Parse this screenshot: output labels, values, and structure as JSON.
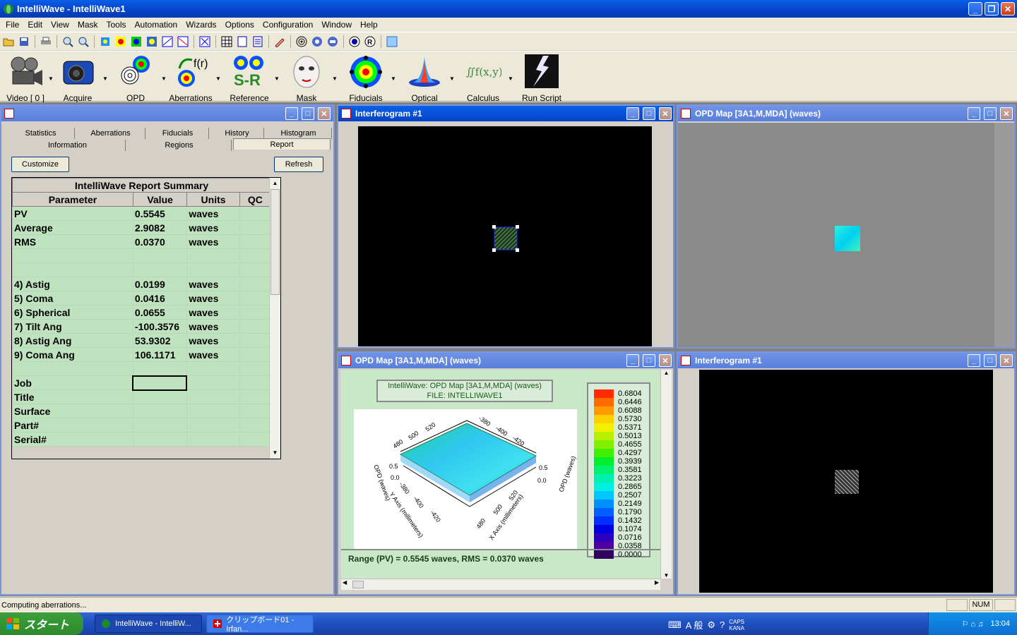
{
  "app": {
    "title": "IntelliWave - IntelliWave1",
    "menu": [
      "File",
      "Edit",
      "View",
      "Mask",
      "Tools",
      "Automation",
      "Wizards",
      "Options",
      "Configuration",
      "Window",
      "Help"
    ],
    "big_toolbar": [
      "Video [ 0 ]",
      "Acquire",
      "OPD",
      "Aberrations",
      "Reference",
      "Mask",
      "Fiducials",
      "Optical",
      "Calculus",
      "Run Script"
    ],
    "sr_text": "S-R",
    "fr_text": "f(r)",
    "calc_text": "∬f(x,y) dx dy",
    "status_text": "Computing aberrations...",
    "num_indicator": "NUM"
  },
  "panel": {
    "tabs_row1": [
      "Statistics",
      "Aberrations",
      "Fiducials",
      "History",
      "Histogram"
    ],
    "tabs_row2": [
      "Information",
      "Regions",
      "Report"
    ],
    "customize_label": "Customize",
    "refresh_label": "Refresh",
    "report_title": "IntelliWave Report Summary",
    "headers": [
      "Parameter",
      "Value",
      "Units",
      "QC"
    ],
    "rows": [
      {
        "p": "PV",
        "v": "0.5545",
        "u": "waves"
      },
      {
        "p": "Average",
        "v": "2.9082",
        "u": "waves"
      },
      {
        "p": "RMS",
        "v": "0.0370",
        "u": "waves"
      },
      {
        "p": "",
        "v": "",
        "u": ""
      },
      {
        "p": "",
        "v": "",
        "u": ""
      },
      {
        "p": " 4) Astig",
        "v": "0.0199",
        "u": "waves"
      },
      {
        "p": " 5) Coma",
        "v": "0.0416",
        "u": "waves"
      },
      {
        "p": " 6) Spherical",
        "v": "0.0655",
        "u": "waves"
      },
      {
        "p": " 7) Tilt Ang",
        "v": "-100.3576",
        "u": "waves"
      },
      {
        "p": " 8) Astig Ang",
        "v": "53.9302",
        "u": "waves"
      },
      {
        "p": " 9) Coma Ang",
        "v": "106.1171",
        "u": "waves"
      },
      {
        "p": "",
        "v": "",
        "u": ""
      },
      {
        "p": "Job",
        "v": "",
        "u": ""
      },
      {
        "p": "Title",
        "v": "",
        "u": ""
      },
      {
        "p": "Surface",
        "v": "",
        "u": ""
      },
      {
        "p": "Part#",
        "v": "",
        "u": ""
      },
      {
        "p": "Serial#",
        "v": "",
        "u": ""
      }
    ]
  },
  "windows": {
    "interferogram_top": "Interferogram #1",
    "opd_top": "OPD Map [3A1,M,MDA]  (waves)",
    "opd_bottom": "OPD Map [3A1,M,MDA]  (waves)",
    "interferogram_bottom": "Interferogram #1"
  },
  "plot": {
    "caption_line1": "IntelliWave: OPD Map [3A1,M,MDA]  (waves)",
    "caption_line2": "FILE: INTELLIWAVE1",
    "range_text": "Range (PV) =   0.5545 waves, RMS =   0.0370 waves",
    "legend_values": [
      "0.6804",
      "0.6446",
      "0.6088",
      "0.5730",
      "0.5371",
      "0.5013",
      "0.4655",
      "0.4297",
      "0.3939",
      "0.3581",
      "0.3223",
      "0.2865",
      "0.2507",
      "0.2149",
      "0.1790",
      "0.1432",
      "0.1074",
      "0.0716",
      "0.0358",
      "0.0000"
    ],
    "legend_colors": [
      "#ff2a00",
      "#ff6a00",
      "#ff9a00",
      "#ffd000",
      "#f0f000",
      "#b8f000",
      "#80f000",
      "#40f000",
      "#00f030",
      "#00f070",
      "#00f0b0",
      "#00f0e0",
      "#00c8ff",
      "#0090ff",
      "#0060ff",
      "#0030ff",
      "#0000e0",
      "#3000c0",
      "#5000a0",
      "#300060"
    ],
    "axis_left_opd": "OPD (waves)",
    "axis_right_opd": "OPD (waves)",
    "y_axis_label": "Y Axis (millimeters)",
    "x_axis_label": "X Axis (millimeters)",
    "ticks_y": [
      "480",
      "500",
      "520"
    ],
    "ticks_x": [
      "-380",
      "-400",
      "-420"
    ],
    "ticks_y2": [
      "-380",
      "-400",
      "-420"
    ],
    "ticks_x2": [
      "480",
      "500",
      "520"
    ],
    "opd_ticks_left": [
      "0.5",
      "0.0"
    ],
    "opd_ticks_right": [
      "0.5",
      "0.0"
    ]
  },
  "taskbar": {
    "start_label": "スタート",
    "tasks": [
      "IntelliWave - IntelliW...",
      "クリップボード01 - Irfan..."
    ],
    "ime_text": "A 般",
    "caps_text": "CAPS KANA",
    "clock": "13:04"
  }
}
